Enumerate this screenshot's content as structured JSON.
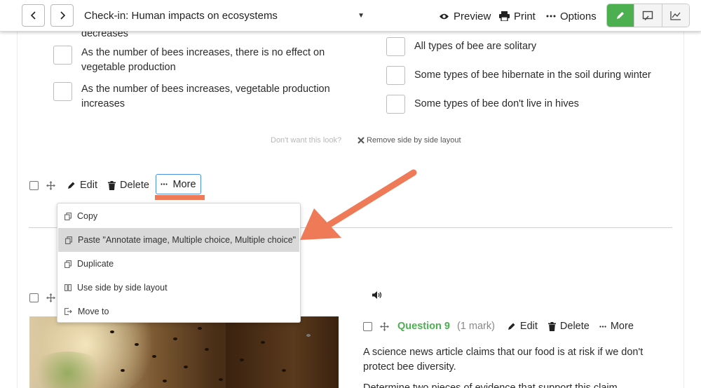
{
  "toolbar": {
    "title": "Check-in: Human impacts on ecosystems",
    "preview_label": "Preview",
    "print_label": "Print",
    "options_label": "Options",
    "accent_color": "#4caf50"
  },
  "options_left": {
    "cut_text": "decreases",
    "items": [
      "As the number of bees increases, there is no effect on vegetable production",
      "As the number of bees increases, vegetable production increases"
    ]
  },
  "options_right": {
    "items": [
      "All types of bee are solitary",
      "Some types of bee hibernate in the soil during winter",
      "Some types of bee don't live in hives"
    ]
  },
  "layout_hint": {
    "question": "Don't want this look?",
    "remove_label": "Remove side by side layout"
  },
  "row_tools": {
    "edit_label": "Edit",
    "delete_label": "Delete",
    "more_label": "More"
  },
  "more_menu": {
    "items": [
      {
        "label": "Copy",
        "icon": "copy-icon"
      },
      {
        "label": "Paste \"Annotate image, Multiple choice, Multiple choice\"",
        "icon": "paste-icon"
      },
      {
        "label": "Duplicate",
        "icon": "duplicate-icon"
      },
      {
        "label": "Use side by side layout",
        "icon": "columns-icon"
      },
      {
        "label": "Move to",
        "icon": "move-to-icon"
      }
    ],
    "highlighted_index": 1
  },
  "question": {
    "number_label": "Question 9",
    "marks_label": "(1 mark)",
    "edit_label": "Edit",
    "delete_label": "Delete",
    "more_label": "More",
    "text_1": "A science news article claims that our food is at risk if we don't protect bee diversity.",
    "text_2": "Determine two pieces of evidence that support this claim"
  },
  "annotation": {
    "arrow_color": "#ee7a58"
  }
}
